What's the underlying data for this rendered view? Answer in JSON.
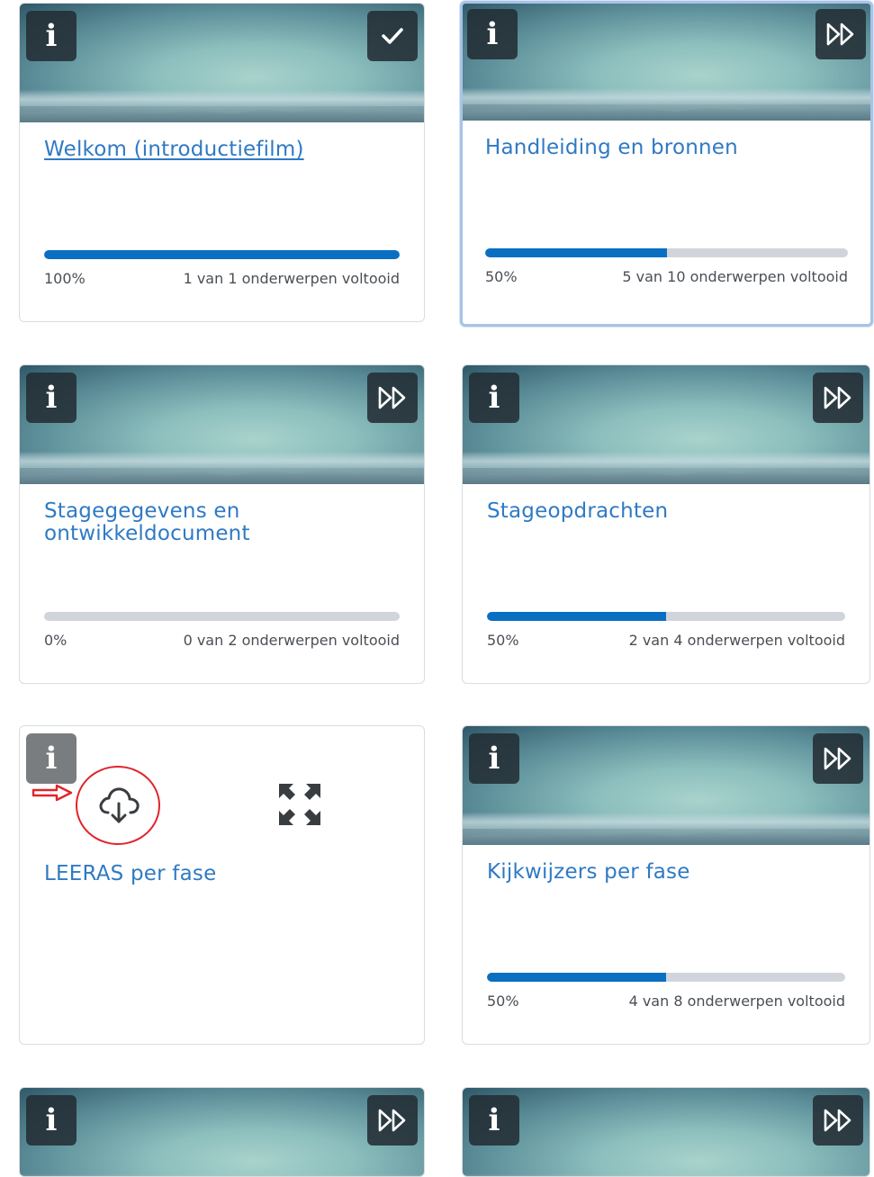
{
  "cards": [
    {
      "title": "Welkom (introductiefilm)",
      "percent_label": "100%",
      "topics_label": "1 van 1 onderwerpen voltooid",
      "progress": 1.0,
      "action_icon": "checkmark-icon"
    },
    {
      "title": "Handleiding en bronnen",
      "percent_label": "50%",
      "topics_label": "5 van 10 onderwerpen voltooid",
      "progress": 0.5,
      "action_icon": "fast-forward-icon"
    },
    {
      "title": "Stagegegevens en ontwikkeldocument",
      "percent_label": "0%",
      "topics_label": "0 van 2 onderwerpen voltooid",
      "progress": 0.0,
      "action_icon": "fast-forward-icon"
    },
    {
      "title": "Stageopdrachten",
      "percent_label": "50%",
      "topics_label": "2 van 4 onderwerpen voltooid",
      "progress": 0.5,
      "action_icon": "fast-forward-icon"
    },
    {
      "title": "LEERAS per fase",
      "download_icon": "cloud-download-icon",
      "expand_icon": "expand-icon",
      "annotation_arrow": "red-arrow-icon"
    },
    {
      "title": "Kijkwijzers per fase",
      "percent_label": "50%",
      "topics_label": "4 van 8 onderwerpen voltooid",
      "progress": 0.5,
      "action_icon": "fast-forward-icon"
    },
    {
      "action_icon": "fast-forward-icon"
    },
    {
      "action_icon": "fast-forward-icon"
    }
  ],
  "info_icon": "info-icon",
  "colors": {
    "link": "#2f7ac4",
    "progress_fill": "#0a6fc2",
    "progress_track": "#d1d5db",
    "annotation": "#e1242b",
    "selected_border": "#a7c3e6"
  }
}
